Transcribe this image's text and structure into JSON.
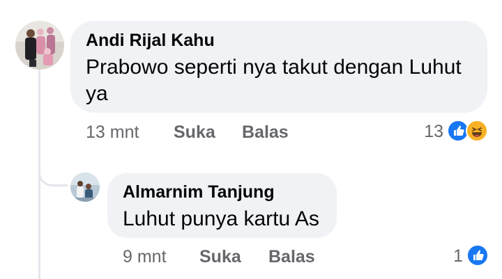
{
  "comments": [
    {
      "author": "Andi Rijal Kahu",
      "text_line1": "Prabowo seperti nya takut dengan Luhut",
      "text_line2": "ya",
      "time": "13 mnt",
      "like_label": "Suka",
      "reply_label": "Balas",
      "reaction_count": "13",
      "reactions": [
        "like-icon",
        "haha-icon"
      ]
    },
    {
      "author": "Almarnim Tanjung",
      "text": "Luhut punya kartu As",
      "time": "9 mnt",
      "like_label": "Suka",
      "reply_label": "Balas",
      "reaction_count": "1",
      "reactions": [
        "like-icon"
      ]
    }
  ],
  "colors": {
    "bubble": "#f0f2f5",
    "meta_text": "#65676b",
    "like_blue": "#1877f2",
    "haha_yellow": "#f7b125"
  }
}
